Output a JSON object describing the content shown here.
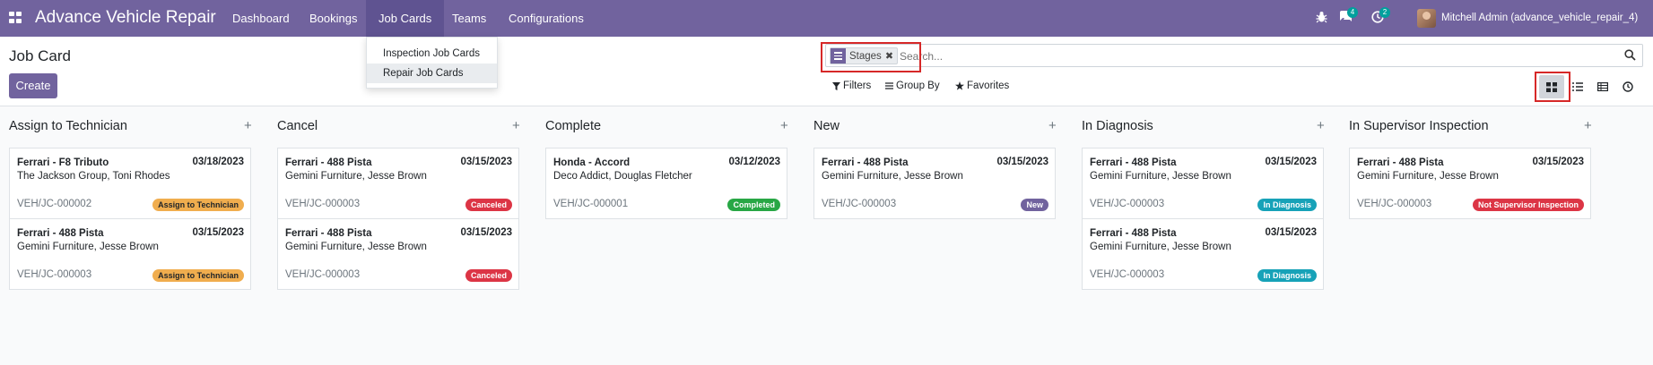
{
  "app": {
    "brand": "Advance Vehicle Repair",
    "menu": [
      "Dashboard",
      "Bookings",
      "Job Cards",
      "Teams",
      "Configurations"
    ],
    "active_menu": "Job Cards",
    "messages_count": "4",
    "activities_count": "2",
    "user": "Mitchell Admin (advance_vehicle_repair_4)"
  },
  "dropdown": {
    "items": [
      "Inspection Job Cards",
      "Repair Job Cards"
    ]
  },
  "control_panel": {
    "title": "Job Card",
    "create_label": "Create",
    "facet_label": "Stages",
    "search_placeholder": "Search...",
    "filters_label": "Filters",
    "groupby_label": "Group By",
    "favorites_label": "Favorites"
  },
  "icons": {
    "apps": "apps-grid-icon",
    "bug": "bug-icon",
    "messages": "chat-icon",
    "activities": "clock-icon",
    "search": "search-icon",
    "filter": "funnel-icon",
    "groupby": "list-icon",
    "favorites": "star-icon",
    "kanban": "kanban-view-icon",
    "list": "list-view-icon",
    "pivot": "pivot-view-icon",
    "activity": "activity-view-icon",
    "add": "plus-icon"
  },
  "colors": {
    "brand": "#71639e",
    "badge_assign": "#f0ad4e",
    "badge_canceled": "#dc3545",
    "badge_completed": "#28a745",
    "badge_new": "#71639e",
    "badge_diagnosis": "#17a2b8",
    "badge_supervisor": "#dc3545"
  },
  "columns": [
    {
      "title": "Assign to Technician",
      "cards": [
        {
          "title": "Ferrari -  F8 Tributo",
          "date": "03/18/2023",
          "customer": "The Jackson Group, Toni Rhodes",
          "ref": "VEH/JC-000002",
          "badge": "Assign to Technician",
          "badge_color": "#f0ad4e",
          "badge_text_color": "#212529"
        },
        {
          "title": "Ferrari -  488 Pista",
          "date": "03/15/2023",
          "customer": "Gemini Furniture, Jesse Brown",
          "ref": "VEH/JC-000003",
          "badge": "Assign to Technician",
          "badge_color": "#f0ad4e",
          "badge_text_color": "#212529"
        }
      ]
    },
    {
      "title": "Cancel",
      "cards": [
        {
          "title": "Ferrari -  488 Pista",
          "date": "03/15/2023",
          "customer": "Gemini Furniture, Jesse Brown",
          "ref": "VEH/JC-000003",
          "badge": "Canceled",
          "badge_color": "#dc3545",
          "badge_text_color": "#ffffff"
        },
        {
          "title": "Ferrari -  488 Pista",
          "date": "03/15/2023",
          "customer": "Gemini Furniture, Jesse Brown",
          "ref": "VEH/JC-000003",
          "badge": "Canceled",
          "badge_color": "#dc3545",
          "badge_text_color": "#ffffff"
        }
      ]
    },
    {
      "title": "Complete",
      "cards": [
        {
          "title": "Honda -  Accord",
          "date": "03/12/2023",
          "customer": "Deco Addict, Douglas Fletcher",
          "ref": "VEH/JC-000001",
          "badge": "Completed",
          "badge_color": "#28a745",
          "badge_text_color": "#ffffff"
        }
      ]
    },
    {
      "title": "New",
      "cards": [
        {
          "title": "Ferrari -  488 Pista",
          "date": "03/15/2023",
          "customer": "Gemini Furniture, Jesse Brown",
          "ref": "VEH/JC-000003",
          "badge": "New",
          "badge_color": "#71639e",
          "badge_text_color": "#ffffff"
        }
      ]
    },
    {
      "title": "In Diagnosis",
      "cards": [
        {
          "title": "Ferrari -  488 Pista",
          "date": "03/15/2023",
          "customer": "Gemini Furniture, Jesse Brown",
          "ref": "VEH/JC-000003",
          "badge": "In Diagnosis",
          "badge_color": "#17a2b8",
          "badge_text_color": "#ffffff"
        },
        {
          "title": "Ferrari -  488 Pista",
          "date": "03/15/2023",
          "customer": "Gemini Furniture, Jesse Brown",
          "ref": "VEH/JC-000003",
          "badge": "In Diagnosis",
          "badge_color": "#17a2b8",
          "badge_text_color": "#ffffff"
        }
      ]
    },
    {
      "title": "In Supervisor Inspection",
      "cards": [
        {
          "title": "Ferrari -  488 Pista",
          "date": "03/15/2023",
          "customer": "Gemini Furniture, Jesse Brown",
          "ref": "VEH/JC-000003",
          "badge": "Not Supervisor Inspection",
          "badge_color": "#dc3545",
          "badge_text_color": "#ffffff"
        }
      ]
    }
  ]
}
